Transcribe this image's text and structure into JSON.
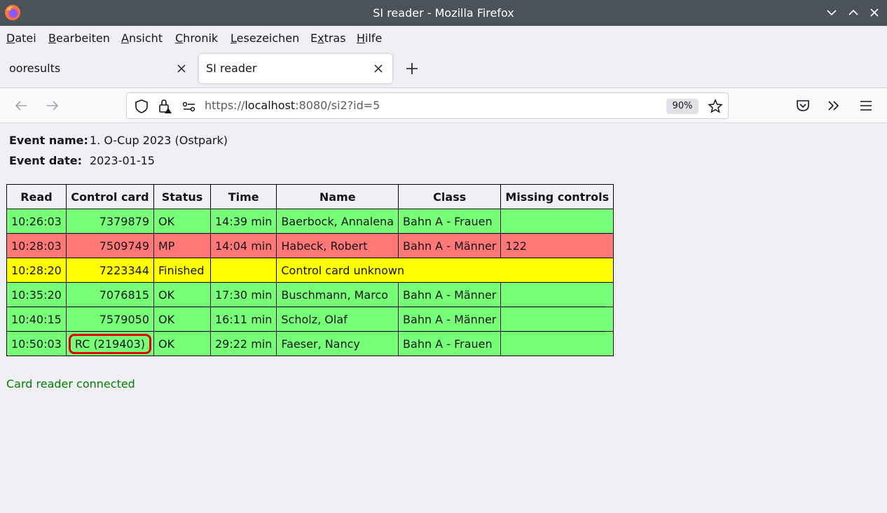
{
  "window": {
    "title": "SI reader - Mozilla Firefox"
  },
  "menu": {
    "items": [
      {
        "acc": "D",
        "rest": "atei"
      },
      {
        "acc": "B",
        "rest": "earbeiten"
      },
      {
        "acc": "A",
        "rest": "nsicht"
      },
      {
        "acc": "C",
        "rest": "hronik"
      },
      {
        "acc": "L",
        "rest": "esezeichen"
      },
      {
        "pre": "E",
        "acc": "x",
        "rest": "tras"
      },
      {
        "acc": "H",
        "rest": "ilfe"
      }
    ]
  },
  "tabs": [
    {
      "label": "ooresults",
      "active": false
    },
    {
      "label": "SI reader",
      "active": true
    }
  ],
  "navbar": {
    "url_scheme": "https://",
    "url_host": "localhost",
    "url_rest": ":8080/si2?id=5",
    "zoom": "90%"
  },
  "event": {
    "name_label": "Event name:",
    "name_value": "1. O-Cup 2023 (Ostpark)",
    "date_label": "Event date:",
    "date_value": "2023-01-15"
  },
  "table": {
    "headers": [
      "Read",
      "Control card",
      "Status",
      "Time",
      "Name",
      "Class",
      "Missing controls"
    ],
    "rows": [
      {
        "read": "10:26:03",
        "card": "7379879",
        "status": "OK",
        "time": "14:39 min",
        "name": "Baerbock, Annalena",
        "class": "Bahn A - Frauen",
        "missing": ""
      },
      {
        "read": "10:28:03",
        "card": "7509749",
        "status": "MP",
        "time": "14:04 min",
        "name": "Habeck, Robert",
        "class": "Bahn A - Männer",
        "missing": "122"
      },
      {
        "read": "10:28:20",
        "card": "7223344",
        "status": "Finished",
        "time": "",
        "name": "Control card unknown",
        "class": "",
        "missing": ""
      },
      {
        "read": "10:35:20",
        "card": "7076815",
        "status": "OK",
        "time": "17:30 min",
        "name": "Buschmann, Marco",
        "class": "Bahn A - Männer",
        "missing": ""
      },
      {
        "read": "10:40:15",
        "card": "7579050",
        "status": "OK",
        "time": "16:11 min",
        "name": "Scholz, Olaf",
        "class": "Bahn A - Männer",
        "missing": ""
      },
      {
        "read": "10:50:03",
        "card": "RC (219403)",
        "status": "OK",
        "time": "29:22 min",
        "name": "Faeser, Nancy",
        "class": "Bahn A - Frauen",
        "missing": ""
      }
    ]
  },
  "status_text": "Card reader connected",
  "colors": {
    "ok_row": "#77ff77",
    "mp_row": "#ff7777",
    "unknown_row": "#ffff00",
    "status_text": "#008000",
    "highlight": "#e00000"
  }
}
